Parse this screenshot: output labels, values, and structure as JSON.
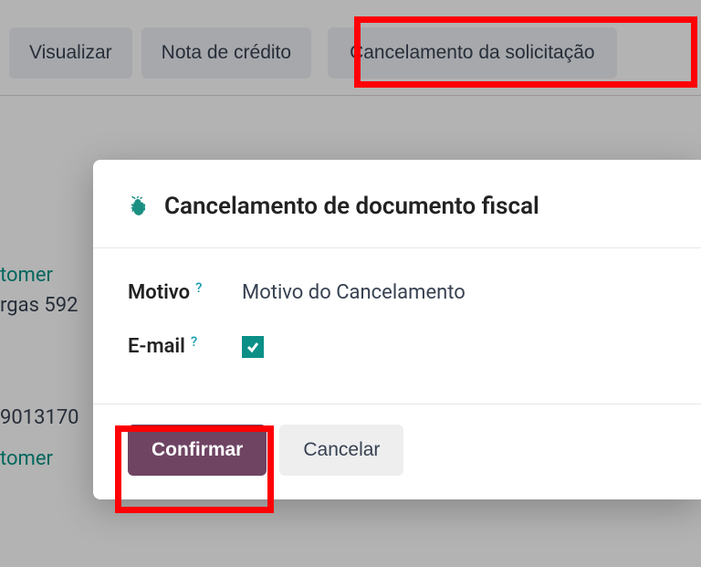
{
  "toolbar": {
    "view_label": "Visualizar",
    "credit_note_label": "Nota de crédito",
    "cancel_request_label": "Cancelamento da solicitação"
  },
  "background": {
    "line1_link": "tomer",
    "line2_text": "rgas 592",
    "line3_num": "9013170",
    "line4_link": "tomer"
  },
  "modal": {
    "title": "Cancelamento de documento fiscal",
    "fields": {
      "reason_label": "Motivo",
      "reason_value": "Motivo do Cancelamento",
      "email_label": "E-mail",
      "email_checked": true
    },
    "footer": {
      "confirm_label": "Confirmar",
      "cancel_label": "Cancelar"
    }
  },
  "icons": {
    "help": "?"
  }
}
